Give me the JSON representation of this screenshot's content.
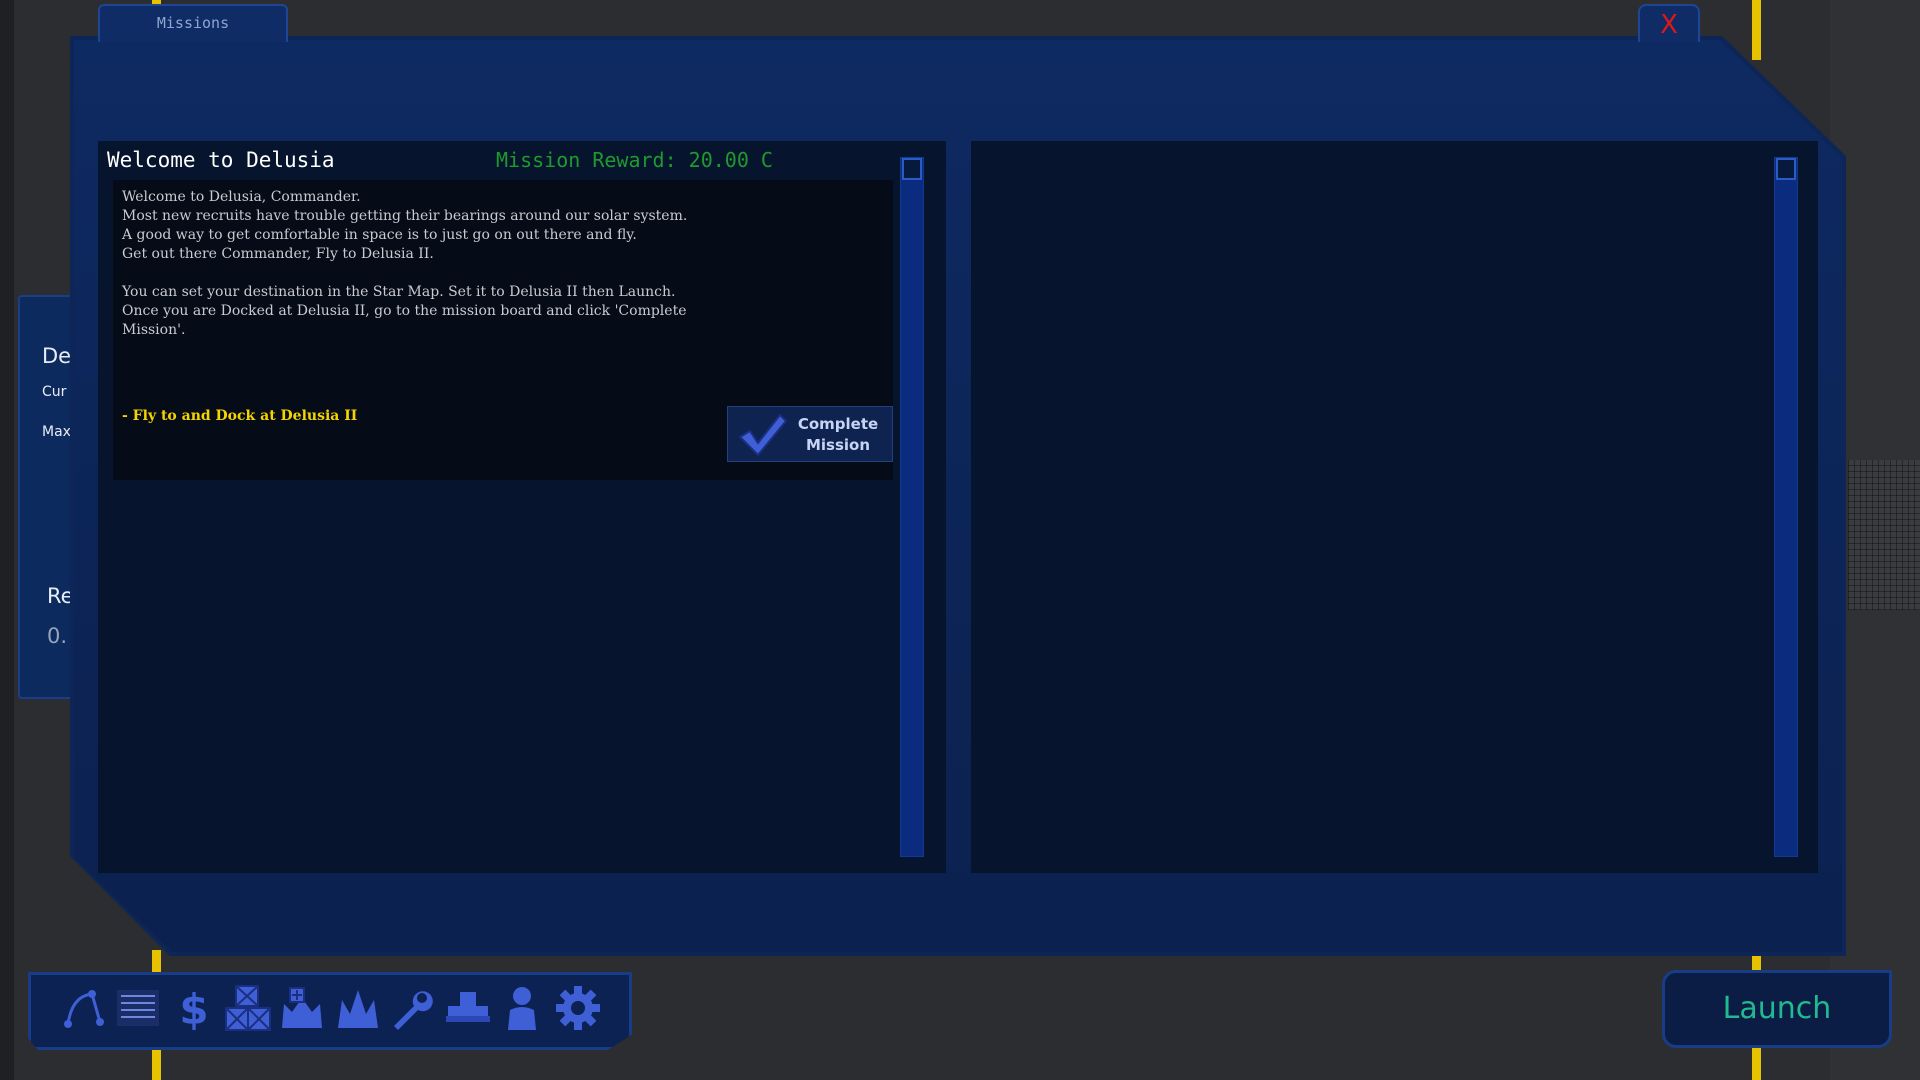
{
  "window_tab": {
    "label": "Missions"
  },
  "close_button": {
    "label": "X"
  },
  "mission": {
    "title": "Welcome to Delusia",
    "reward": "Mission Reward: 20.00 C",
    "body": "Welcome to Delusia, Commander.\nMost new recruits have trouble getting their bearings around our solar system.\nA good way to get comfortable in space is to just go on out there and fly.\nGet out there Commander, Fly to Delusia II.\n\nYou can set your destination in the Star Map. Set it to Delusia II then Launch.\nOnce you are Docked at Delusia II, go to the mission board and click 'Complete\nMission'.",
    "objective": "- Fly to and Dock at Delusia II",
    "complete_button": "Complete\nMission"
  },
  "background_panel": {
    "line1": "De",
    "line2": "Cur",
    "line3": "Max",
    "line4": "Re",
    "line5": "0."
  },
  "toolbar": {
    "icons": [
      "star-map-icon",
      "mission-board-icon",
      "market-icon",
      "cargo-icon",
      "shipyard-icon",
      "fleet-icon",
      "repair-icon",
      "equipment-icon",
      "crew-icon",
      "settings-icon"
    ]
  },
  "launch_button": {
    "label": "Launch"
  },
  "colors": {
    "accent_blue": "#0d2657",
    "reward_green": "#1e9a2e",
    "objective_yellow": "#f5d400",
    "launch_teal": "#21b98f",
    "close_red": "#e01818",
    "icon_blue": "#3f5fd6"
  }
}
